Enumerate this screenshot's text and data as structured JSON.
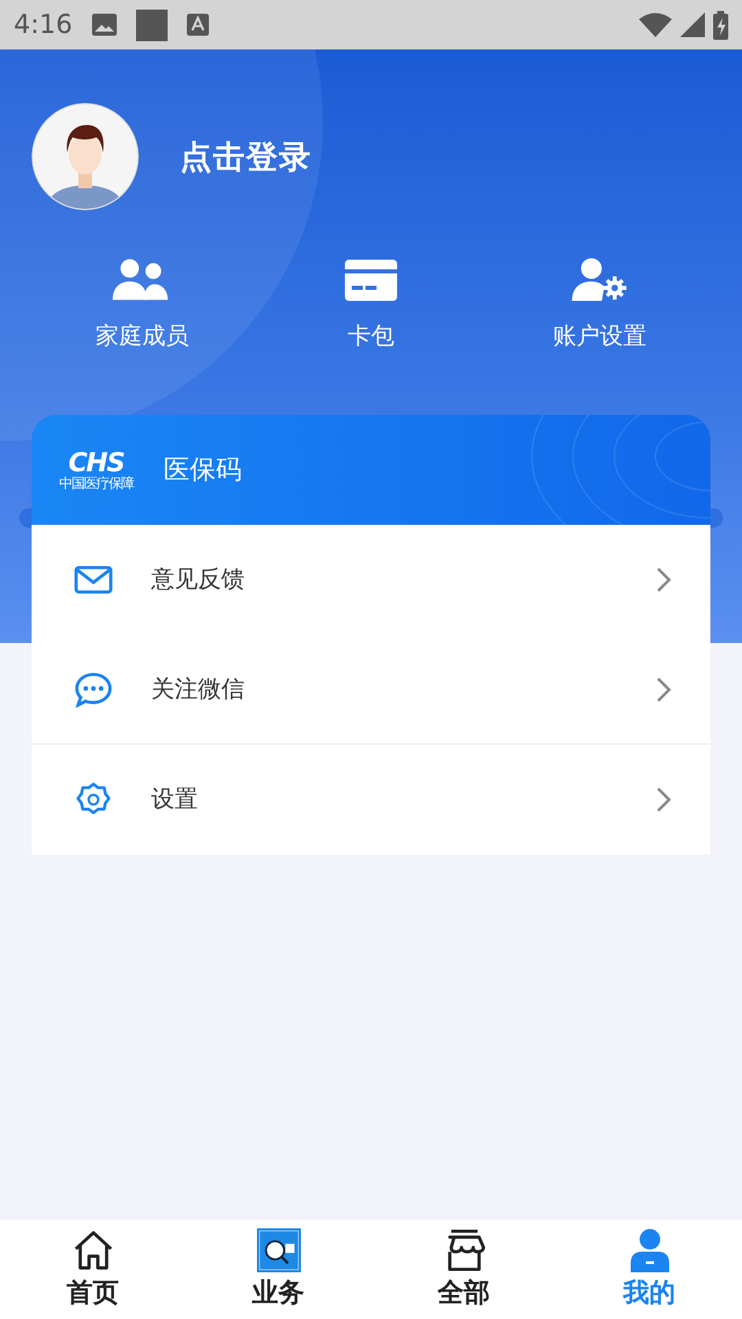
{
  "status_bar": {
    "time": "4:16"
  },
  "profile": {
    "login_label": "点击登录"
  },
  "shortcuts": [
    {
      "kind": "family",
      "label": "家庭成员"
    },
    {
      "kind": "card",
      "label": "卡包"
    },
    {
      "kind": "account",
      "label": "账户设置"
    }
  ],
  "insurance_card": {
    "logo_text": "CHS",
    "logo_subtext": "中国医疗保障",
    "title": "医保码"
  },
  "menu": [
    {
      "kind": "mail",
      "label": "意见反馈",
      "divider_below": false
    },
    {
      "kind": "chat",
      "label": "关注微信",
      "divider_below": true
    },
    {
      "kind": "settings",
      "label": "设置",
      "divider_below": false
    }
  ],
  "bottom_nav": [
    {
      "kind": "home",
      "label": "首页",
      "selected": false
    },
    {
      "kind": "hot",
      "label": "业务",
      "selected": false
    },
    {
      "kind": "store",
      "label": "全部",
      "selected": false
    },
    {
      "kind": "me",
      "label": "我的",
      "selected": true
    }
  ]
}
